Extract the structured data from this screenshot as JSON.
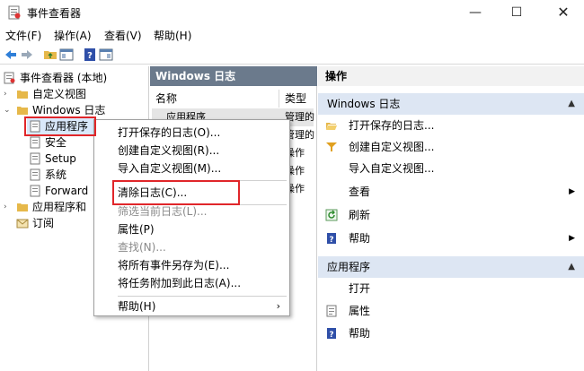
{
  "window": {
    "title": "事件查看器",
    "min": "—",
    "max": "☐",
    "close": "✕"
  },
  "menubar": [
    "文件(F)",
    "操作(A)",
    "查看(V)",
    "帮助(H)"
  ],
  "tree": {
    "root": "事件查看器 (本地)",
    "custom_views": "自定义视图",
    "windows_logs": "Windows 日志",
    "application": "应用程序",
    "security": "安全",
    "setup": "Setup",
    "system": "系统",
    "forwarded": "Forward",
    "apps_services": "应用程序和",
    "subscriptions": "订阅"
  },
  "middle": {
    "header": "Windows 日志",
    "col_name": "名称",
    "col_type": "类型",
    "rows": [
      {
        "name": "应用程序",
        "type": "管理的"
      },
      {
        "name": "",
        "type": "管理的"
      },
      {
        "name": "",
        "type": "操作"
      },
      {
        "name": "",
        "type": "操作"
      },
      {
        "name": "",
        "type": "操作"
      }
    ]
  },
  "right": {
    "header": "操作",
    "section1": "Windows 日志",
    "items1": [
      {
        "label": "打开保存的日志...",
        "icon": "folder-open-icon"
      },
      {
        "label": "创建自定义视图...",
        "icon": "filter-icon"
      },
      {
        "label": "导入自定义视图...",
        "icon": ""
      },
      {
        "label": "查看",
        "icon": "",
        "arrow": "▶"
      },
      {
        "label": "刷新",
        "icon": "refresh-icon"
      },
      {
        "label": "帮助",
        "icon": "help-icon",
        "arrow": "▶"
      }
    ],
    "section2": "应用程序",
    "items2": [
      {
        "label": "打开",
        "icon": ""
      },
      {
        "label": "属性",
        "icon": "properties-icon"
      },
      {
        "label": "帮助",
        "icon": "help-icon"
      }
    ]
  },
  "context_menu": {
    "items": [
      {
        "label": "打开保存的日志(O)...",
        "disabled": false
      },
      {
        "label": "创建自定义视图(R)...",
        "disabled": false
      },
      {
        "label": "导入自定义视图(M)...",
        "disabled": false
      },
      {
        "label": "清除日志(C)...",
        "disabled": false
      },
      {
        "label": "筛选当前日志(L)...",
        "disabled": true
      },
      {
        "label": "属性(P)",
        "disabled": false
      },
      {
        "label": "查找(N)...",
        "disabled": true
      },
      {
        "label": "将所有事件另存为(E)...",
        "disabled": false
      },
      {
        "label": "将任务附加到此日志(A)...",
        "disabled": false
      },
      {
        "label": "帮助(H)",
        "disabled": false
      }
    ],
    "submenu_arrow": "›"
  },
  "colors": {
    "highlight_border": "#e0262a",
    "panel_header": "#6b7a8c",
    "section_bg": "#dde6f3"
  }
}
